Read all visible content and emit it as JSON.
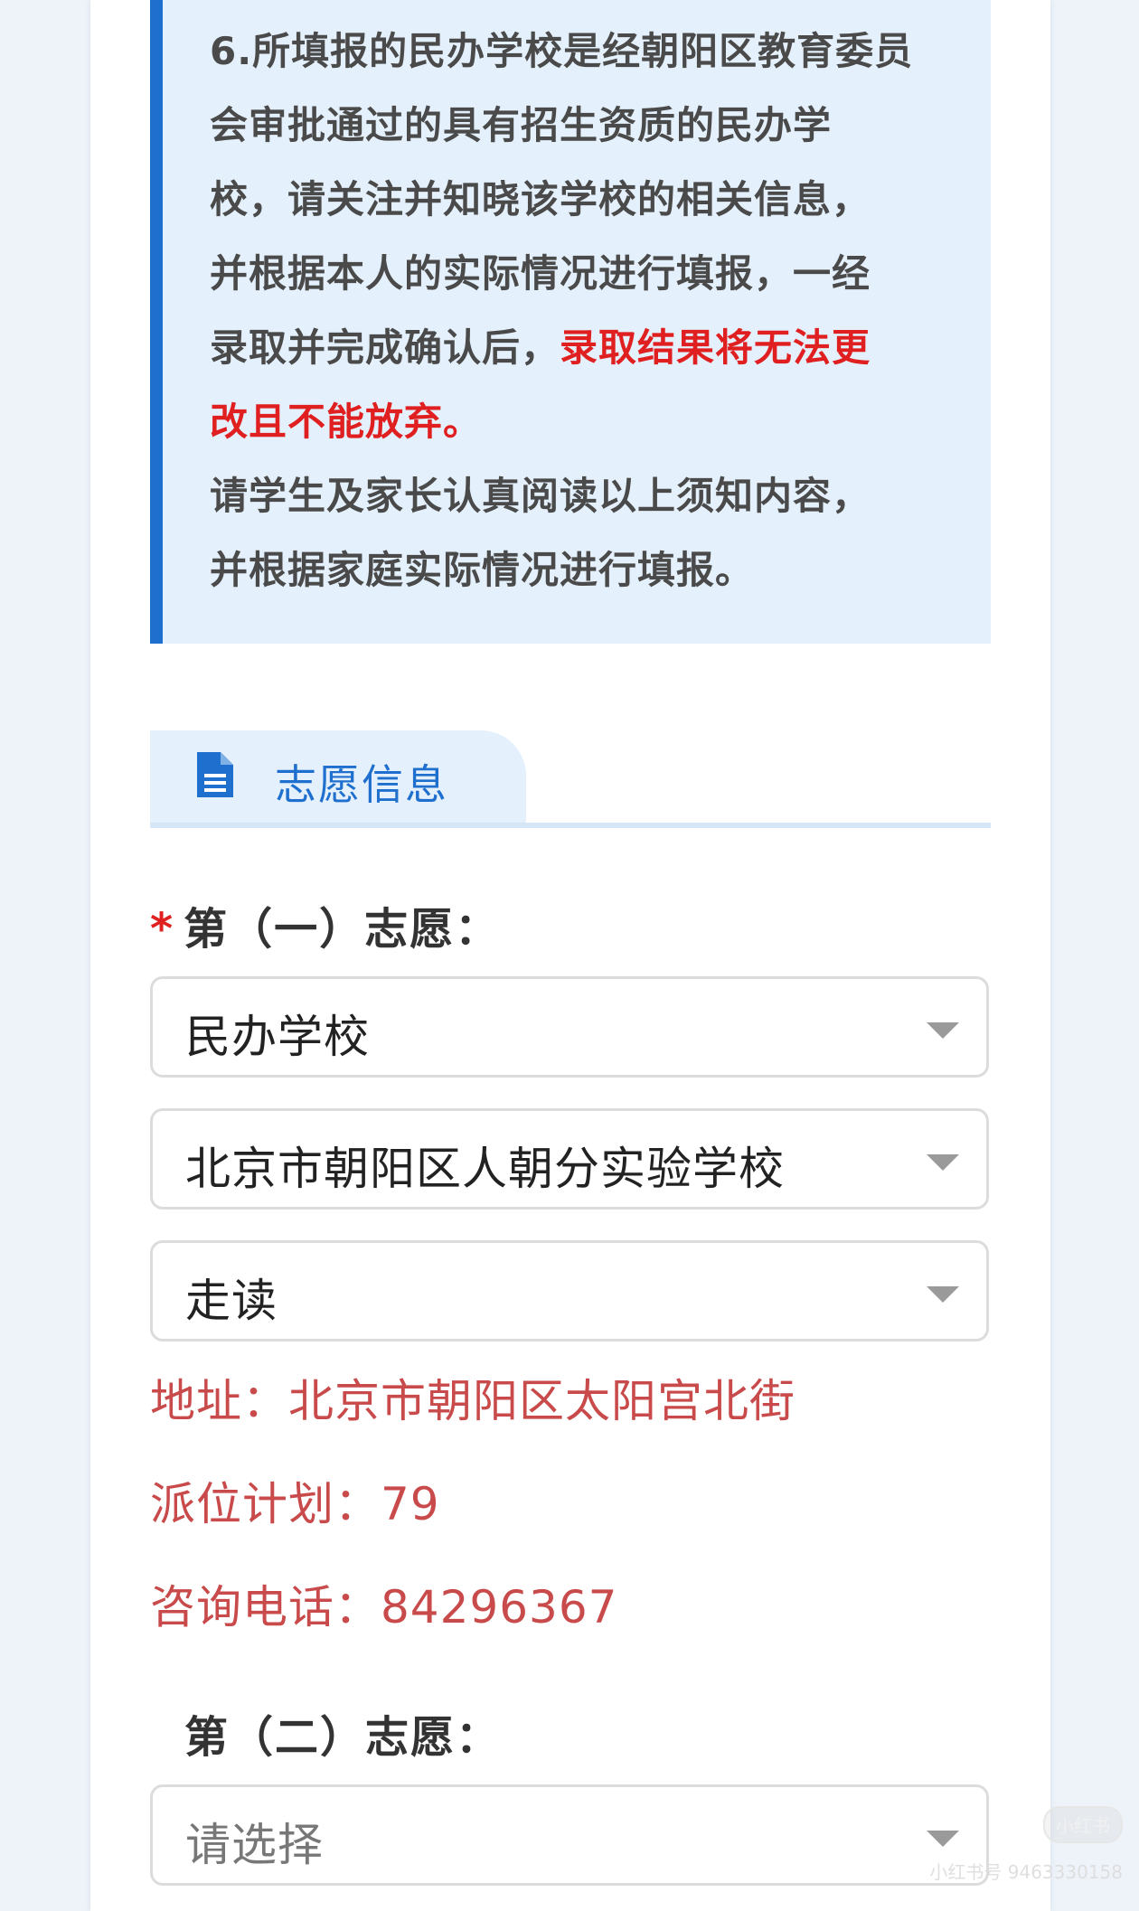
{
  "notice": {
    "lines": [
      "6.所填报的民办学校是经朝阳区教育委员",
      "会审批通过的具有招生资质的民办学",
      "校，请关注并知晓该学校的相关信息，",
      "并根据本人的实际情况进行填报，一经",
      "录取并完成确认后，",
      "录取结果将无法更",
      "改且不能放弃。",
      "请学生及家长认真阅读以上须知内容，",
      "并根据家庭实际情况进行填报。"
    ]
  },
  "section": {
    "title": "志愿信息",
    "icon": "document-icon"
  },
  "choice1": {
    "required_mark": "*",
    "label": "第（一）志愿：",
    "school_type": "民办学校",
    "school_name": "北京市朝阳区人朝分实验学校",
    "boarding": "走读",
    "address": "地址：北京市朝阳区太阳宫北街",
    "plan": "派位计划：79",
    "phone": "咨询电话：84296367"
  },
  "choice2": {
    "label": "第（二）志愿：",
    "placeholder": "请选择"
  },
  "watermark": {
    "logo": "小红书",
    "id": "小红书号 9463330158"
  },
  "colors": {
    "accent": "#1f6fce",
    "notice_bg": "#e4f0fb",
    "warning_red": "#e02020",
    "info_red": "#c94a4a"
  }
}
